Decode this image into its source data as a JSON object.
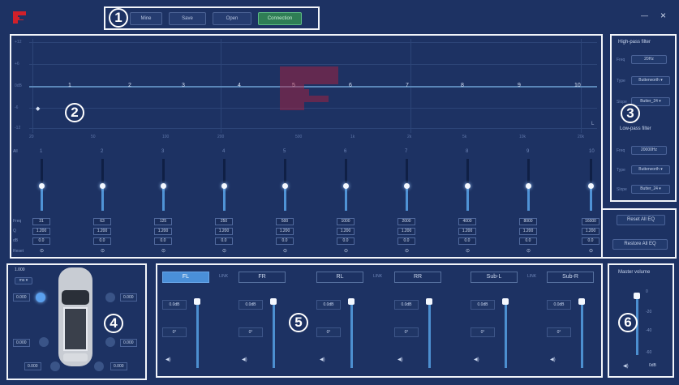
{
  "toolbar": {
    "buttons": [
      "Mine",
      "Save",
      "Open",
      "Connection"
    ],
    "callout": "1"
  },
  "window": {
    "minimize": "—",
    "close": "×"
  },
  "eq_graph": {
    "callout": "2",
    "y_ticks": [
      "+12",
      "+6",
      "0dB",
      "-6",
      "-12"
    ],
    "x_ticks": [
      "20",
      "50",
      "100",
      "200",
      "500",
      "1k",
      "2k",
      "5k",
      "10k",
      "20k"
    ],
    "points": [
      "1",
      "2",
      "3",
      "4",
      "5",
      "6",
      "7",
      "8",
      "9",
      "10"
    ],
    "corner_label": "L"
  },
  "eq_bands": {
    "row_labels": {
      "freq": "Freq",
      "q": "Q",
      "gain": "dB",
      "reset": "Reset"
    },
    "all_label": "All",
    "bands": [
      {
        "num": "1",
        "freq": "31",
        "q": "1.200",
        "gain": "0.0"
      },
      {
        "num": "2",
        "freq": "63",
        "q": "1.200",
        "gain": "0.0"
      },
      {
        "num": "3",
        "freq": "125",
        "q": "1.200",
        "gain": "0.0"
      },
      {
        "num": "4",
        "freq": "250",
        "q": "1.200",
        "gain": "0.0"
      },
      {
        "num": "5",
        "freq": "500",
        "q": "1.200",
        "gain": "0.0"
      },
      {
        "num": "6",
        "freq": "1000",
        "q": "1.200",
        "gain": "0.0"
      },
      {
        "num": "7",
        "freq": "2000",
        "q": "1.200",
        "gain": "0.0"
      },
      {
        "num": "8",
        "freq": "4000",
        "q": "1.200",
        "gain": "0.0"
      },
      {
        "num": "9",
        "freq": "8000",
        "q": "1.200",
        "gain": "0.0"
      },
      {
        "num": "10",
        "freq": "16000",
        "q": "1.200",
        "gain": "0.0"
      }
    ]
  },
  "filters": {
    "callout": "3",
    "high_pass": {
      "title": "High-pass filter",
      "freq_label": "Freq",
      "freq": "20Hz",
      "type_label": "Type",
      "type": "Butterworth",
      "slope_label": "Slope",
      "slope": "Butter_24"
    },
    "low_pass": {
      "title": "Low-pass filter",
      "freq_label": "Freq",
      "freq": "20000Hz",
      "type_label": "Type",
      "type": "Butterworth",
      "slope_label": "Slope",
      "slope": "Butter_24"
    }
  },
  "eq_actions": {
    "reset": "Reset All EQ",
    "restore": "Restore All EQ"
  },
  "delay": {
    "callout": "4",
    "unit": "1.000",
    "mode": "ms",
    "values": [
      "0.000",
      "0.000",
      "0.000",
      "0.000",
      "0.000",
      "0.000"
    ]
  },
  "channels": {
    "callout": "5",
    "link_label": "LINK",
    "items": [
      {
        "name": "FL",
        "gain": "0.0dB",
        "phase": "0°",
        "mute": "◀)"
      },
      {
        "name": "FR",
        "gain": "0.0dB",
        "phase": "0°",
        "mute": "◀)"
      },
      {
        "name": "RL",
        "gain": "0.0dB",
        "phase": "0°",
        "mute": "◀)"
      },
      {
        "name": "RR",
        "gain": "0.0dB",
        "phase": "0°",
        "mute": "◀)"
      },
      {
        "name": "Sub-L",
        "gain": "0.0dB",
        "phase": "0°",
        "mute": "◀)"
      },
      {
        "name": "Sub-R",
        "gain": "0.0dB",
        "phase": "0°",
        "mute": "◀)"
      }
    ],
    "active": "FL"
  },
  "master": {
    "callout": "6",
    "title": "Master volume",
    "ticks": [
      "0",
      "-20",
      "-40",
      "-60"
    ],
    "mute": "◀)",
    "value": "0dB",
    "level_fraction": 1.0
  },
  "colors": {
    "bg": "#1d3263",
    "accent": "#4a8fd8",
    "connect": "#2f7e55",
    "logo": "#d0202a"
  }
}
